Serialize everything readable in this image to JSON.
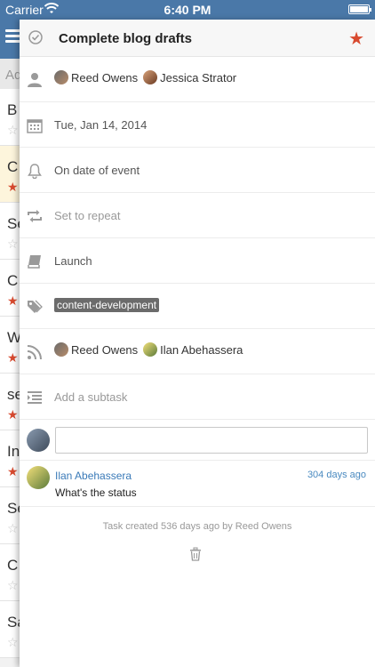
{
  "status_bar": {
    "carrier": "Carrier",
    "time": "6:40 PM"
  },
  "background_list": {
    "add_placeholder": "Ad",
    "items": [
      {
        "initial": "B",
        "star": "☆"
      },
      {
        "initial": "C",
        "star": "★"
      },
      {
        "initial": "Se",
        "star": "☆"
      },
      {
        "initial": "C",
        "star": "★"
      },
      {
        "initial": "W",
        "star": "★"
      },
      {
        "initial": "se",
        "star": "★"
      },
      {
        "initial": "In",
        "star": "★"
      },
      {
        "initial": "Se",
        "star": "☆"
      },
      {
        "initial": "C",
        "star": "☆"
      },
      {
        "initial": "Sa",
        "star": "☆"
      }
    ]
  },
  "task": {
    "title": "Complete blog drafts",
    "assignees": [
      "Reed Owens",
      "Jessica Strator"
    ],
    "due_date": "Tue, Jan 14, 2014",
    "reminder": "On date of event",
    "repeat": "Set to repeat",
    "list": "Launch",
    "tag": "content-development",
    "followers": [
      "Reed Owens",
      "Ilan Abehassera"
    ],
    "subtask_placeholder": "Add a subtask",
    "comment": {
      "author": "Ilan Abehassera",
      "ago": "304 days ago",
      "body": "What's the status"
    },
    "created_text": "Task created 536 days ago by Reed Owens"
  },
  "colors": {
    "header": "#4a78a8",
    "star": "#d84a2f",
    "link": "#3a7ab8"
  }
}
